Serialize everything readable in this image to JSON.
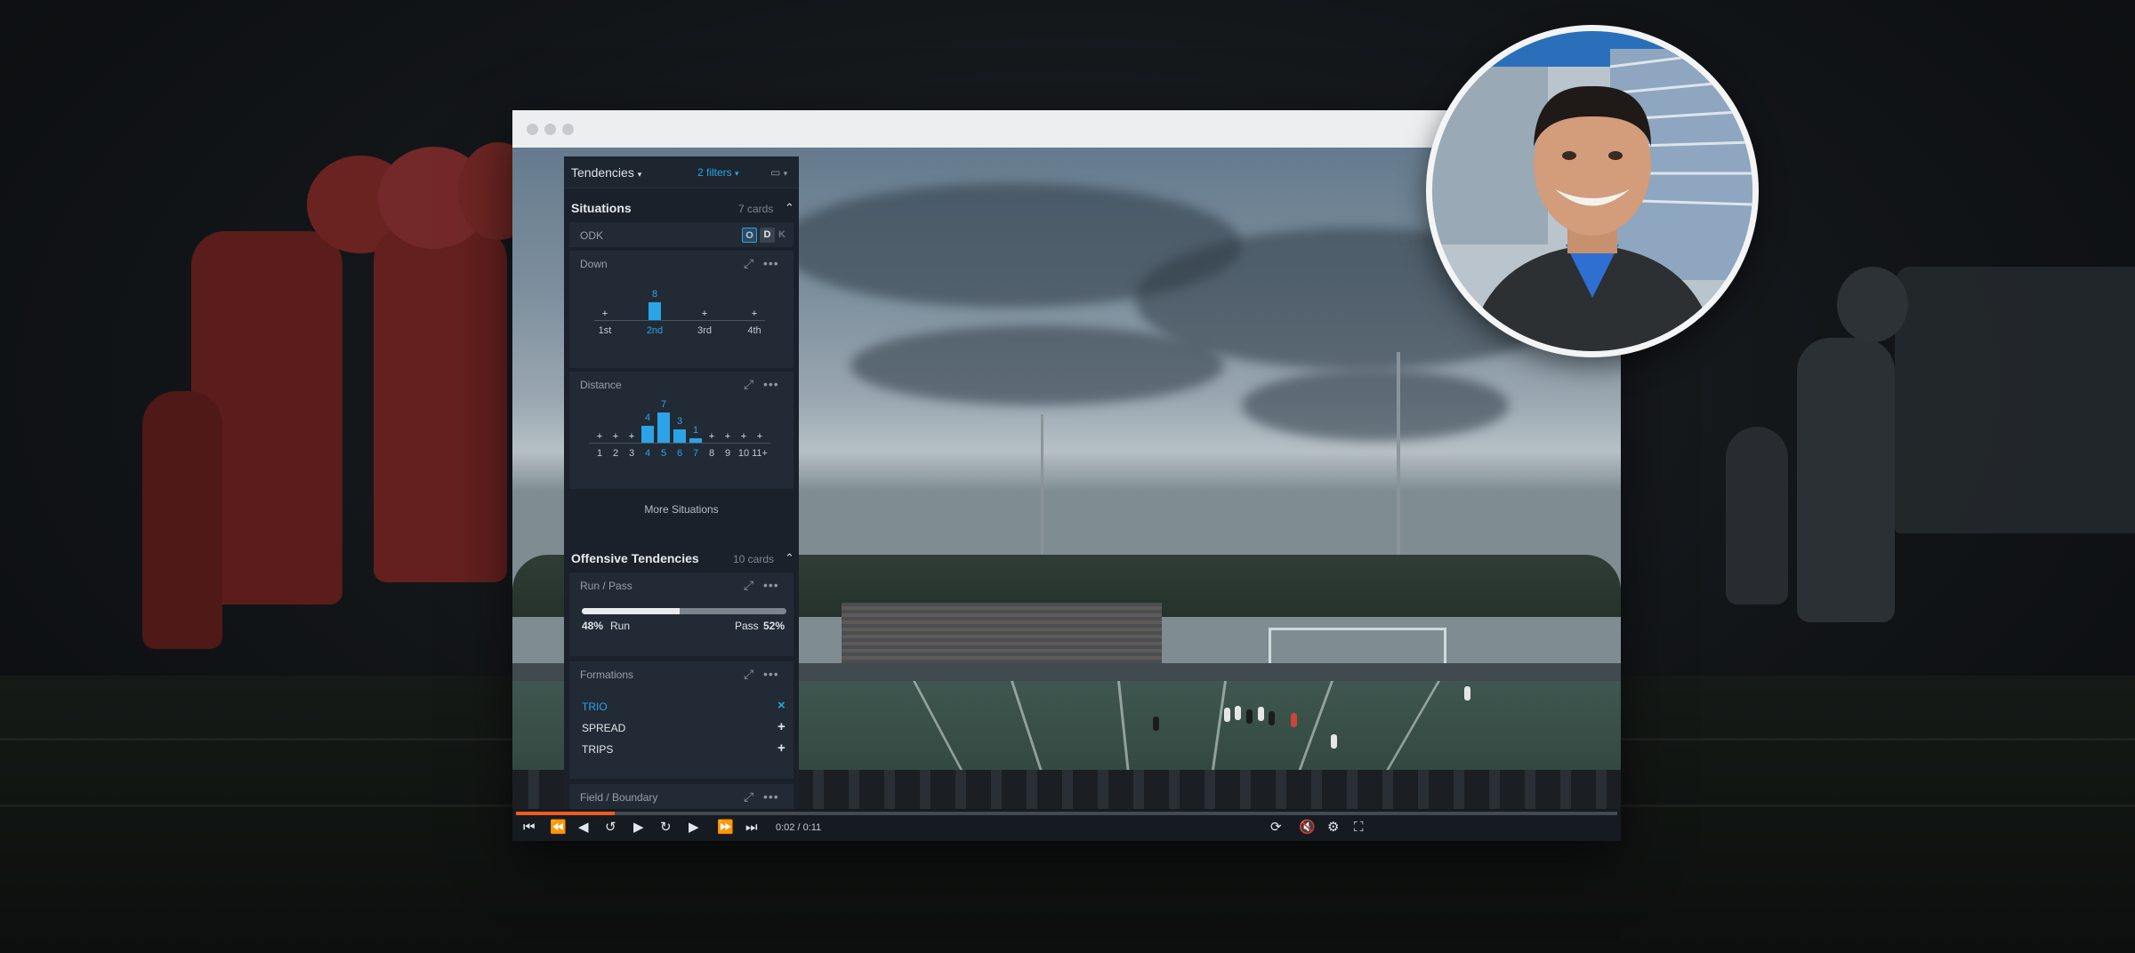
{
  "window": {
    "titlebar_buttons": [
      "close",
      "minimize",
      "maximize"
    ]
  },
  "panel": {
    "title": "Tendencies",
    "filters_label": "2 filters",
    "layout_icon": "layout-icon",
    "situations": {
      "title": "Situations",
      "count": "7 cards",
      "odk": {
        "label": "ODK",
        "options": [
          "O",
          "D",
          "K"
        ]
      },
      "down": {
        "label": "Down",
        "chart_data": {
          "type": "bar",
          "categories": [
            "1st",
            "2nd",
            "3rd",
            "4th"
          ],
          "values": [
            0,
            8,
            0,
            0
          ],
          "value_labels": [
            "",
            "8",
            "",
            ""
          ]
        }
      },
      "distance": {
        "label": "Distance",
        "chart_data": {
          "type": "bar",
          "categories": [
            "1",
            "2",
            "3",
            "4",
            "5",
            "6",
            "7",
            "8",
            "9",
            "10",
            "11+"
          ],
          "values": [
            0,
            0,
            0,
            4,
            7,
            3,
            1,
            0,
            0,
            0,
            0
          ],
          "value_labels": [
            "",
            "",
            "",
            "4",
            "7",
            "3",
            "1",
            "",
            "",
            "",
            ""
          ]
        }
      },
      "more_label": "More Situations"
    },
    "offensive": {
      "title": "Offensive Tendencies",
      "count": "10 cards",
      "run_pass": {
        "label": "Run / Pass",
        "run_pct": "48%",
        "run_label": "Run",
        "pass_label": "Pass",
        "pass_pct": "52%",
        "run_fraction": 0.48
      },
      "formations": {
        "label": "Formations",
        "items": [
          {
            "name": "TRIO",
            "selected": true,
            "action": "×"
          },
          {
            "name": "SPREAD",
            "selected": false,
            "action": "+"
          },
          {
            "name": "TRIPS",
            "selected": false,
            "action": "+"
          }
        ]
      },
      "field_boundary": {
        "label": "Field / Boundary"
      }
    }
  },
  "player": {
    "time": "0:02 / 0:11",
    "progress_fraction": 0.09,
    "colors": {
      "progress": "#f25b1f",
      "accent": "#2aa4e6"
    }
  }
}
